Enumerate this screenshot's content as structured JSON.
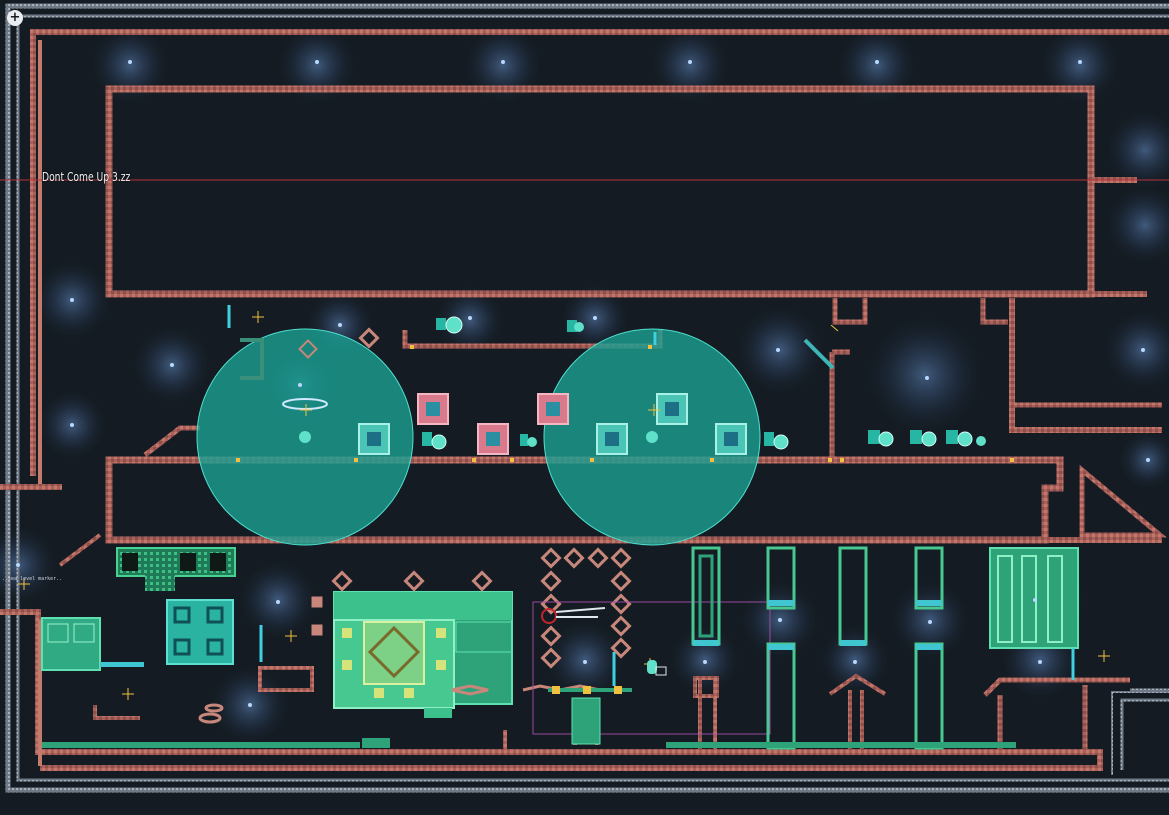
{
  "editor": {
    "add_button_label": "+",
    "room_title": "Dont Come Up 3.zz",
    "left_note": "..sea level marker.."
  },
  "palette": {
    "background": "#141b22",
    "solid_wall": "#b3675a",
    "wall_edge": "#dd8a79",
    "outer_frame": "#8d98a4",
    "teal_zone": "#1aa092",
    "green_block": "#35b878",
    "pink_block": "#d87a8c",
    "light_glow": "#3a5478",
    "guide_line": "#b8303a",
    "selection": "#9a4aa0",
    "marker": "#f0c040"
  }
}
